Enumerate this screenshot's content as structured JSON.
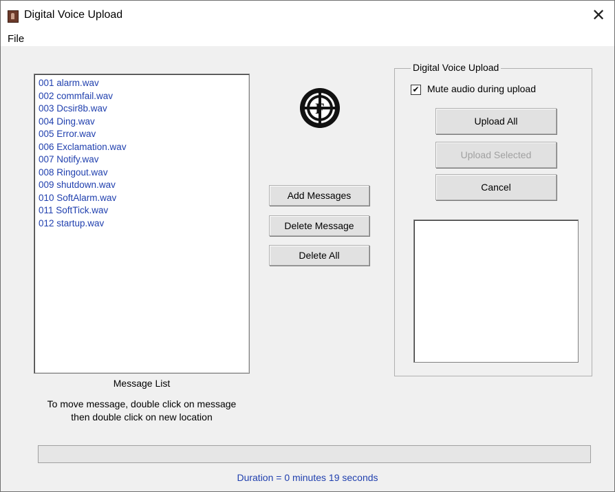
{
  "window": {
    "title": "Digital Voice Upload",
    "close_glyph": "✕",
    "app_icon": "microphone-app-icon"
  },
  "menu": {
    "file_label": "File"
  },
  "message_list": {
    "items": [
      "001 alarm.wav",
      "002 commfail.wav",
      "003 Dcsir8b.wav",
      "004 Ding.wav",
      "005 Error.wav",
      "006 Exclamation.wav",
      "007 Notify.wav",
      "008 Ringout.wav",
      "009 shutdown.wav",
      "010 SoftAlarm.wav",
      "011 SoftTick.wav",
      "012 startup.wav"
    ],
    "label": "Message List",
    "hint_line1": "To move message, double click on message",
    "hint_line2": "then double click on new location"
  },
  "actions": {
    "add_label": "Add Messages",
    "delete_label": "Delete Message",
    "delete_all_label": "Delete All"
  },
  "upload_group": {
    "title": "Digital Voice Upload",
    "mute_label": "Mute audio during upload",
    "mute_checked": true,
    "upload_all_label": "Upload All",
    "upload_selected_label": "Upload Selected",
    "cancel_label": "Cancel"
  },
  "status": {
    "duration_text": "Duration = 0 minutes 19 seconds",
    "progress": 0
  },
  "colors": {
    "list_text": "#1f3fae",
    "window_bg": "#f0f0f0"
  }
}
